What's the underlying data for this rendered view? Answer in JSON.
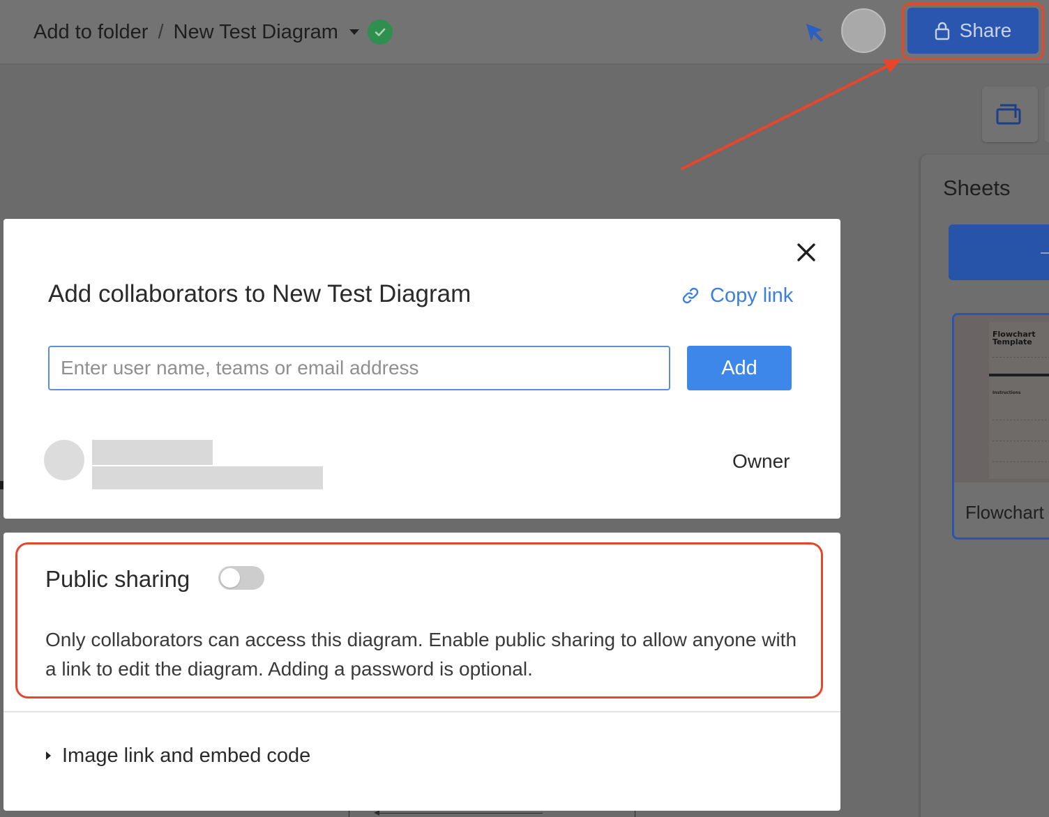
{
  "header": {
    "breadcrumb_root": "Add to folder",
    "separator": "/",
    "document_title": "New Test Diagram",
    "share_label": "Share"
  },
  "sidebar": {
    "sheets_title": "Sheets",
    "thumbnail": {
      "preview_title_line1": "Flowchart",
      "preview_title_line2": "Template",
      "preview_section": "Instructions",
      "label": "Flowchart"
    }
  },
  "dialog": {
    "title": "Add collaborators to New Test Diagram",
    "copy_link_label": "Copy link",
    "invite_input": {
      "value": "",
      "placeholder": "Enter user name, teams or email address"
    },
    "add_label": "Add",
    "collaborators": [
      {
        "role": "Owner"
      }
    ],
    "public_sharing": {
      "label": "Public sharing",
      "enabled": false,
      "description": "Only collaborators can access this diagram. Enable public sharing to allow anyone with a link to edit the diagram. Adding a password is optional."
    },
    "embed_section_label": "Image link and embed code"
  },
  "colors": {
    "annotation": "#e8462b",
    "primary_button": "#3d86ea",
    "link": "#3a7fe0",
    "saved_check": "#2f8f4e"
  }
}
